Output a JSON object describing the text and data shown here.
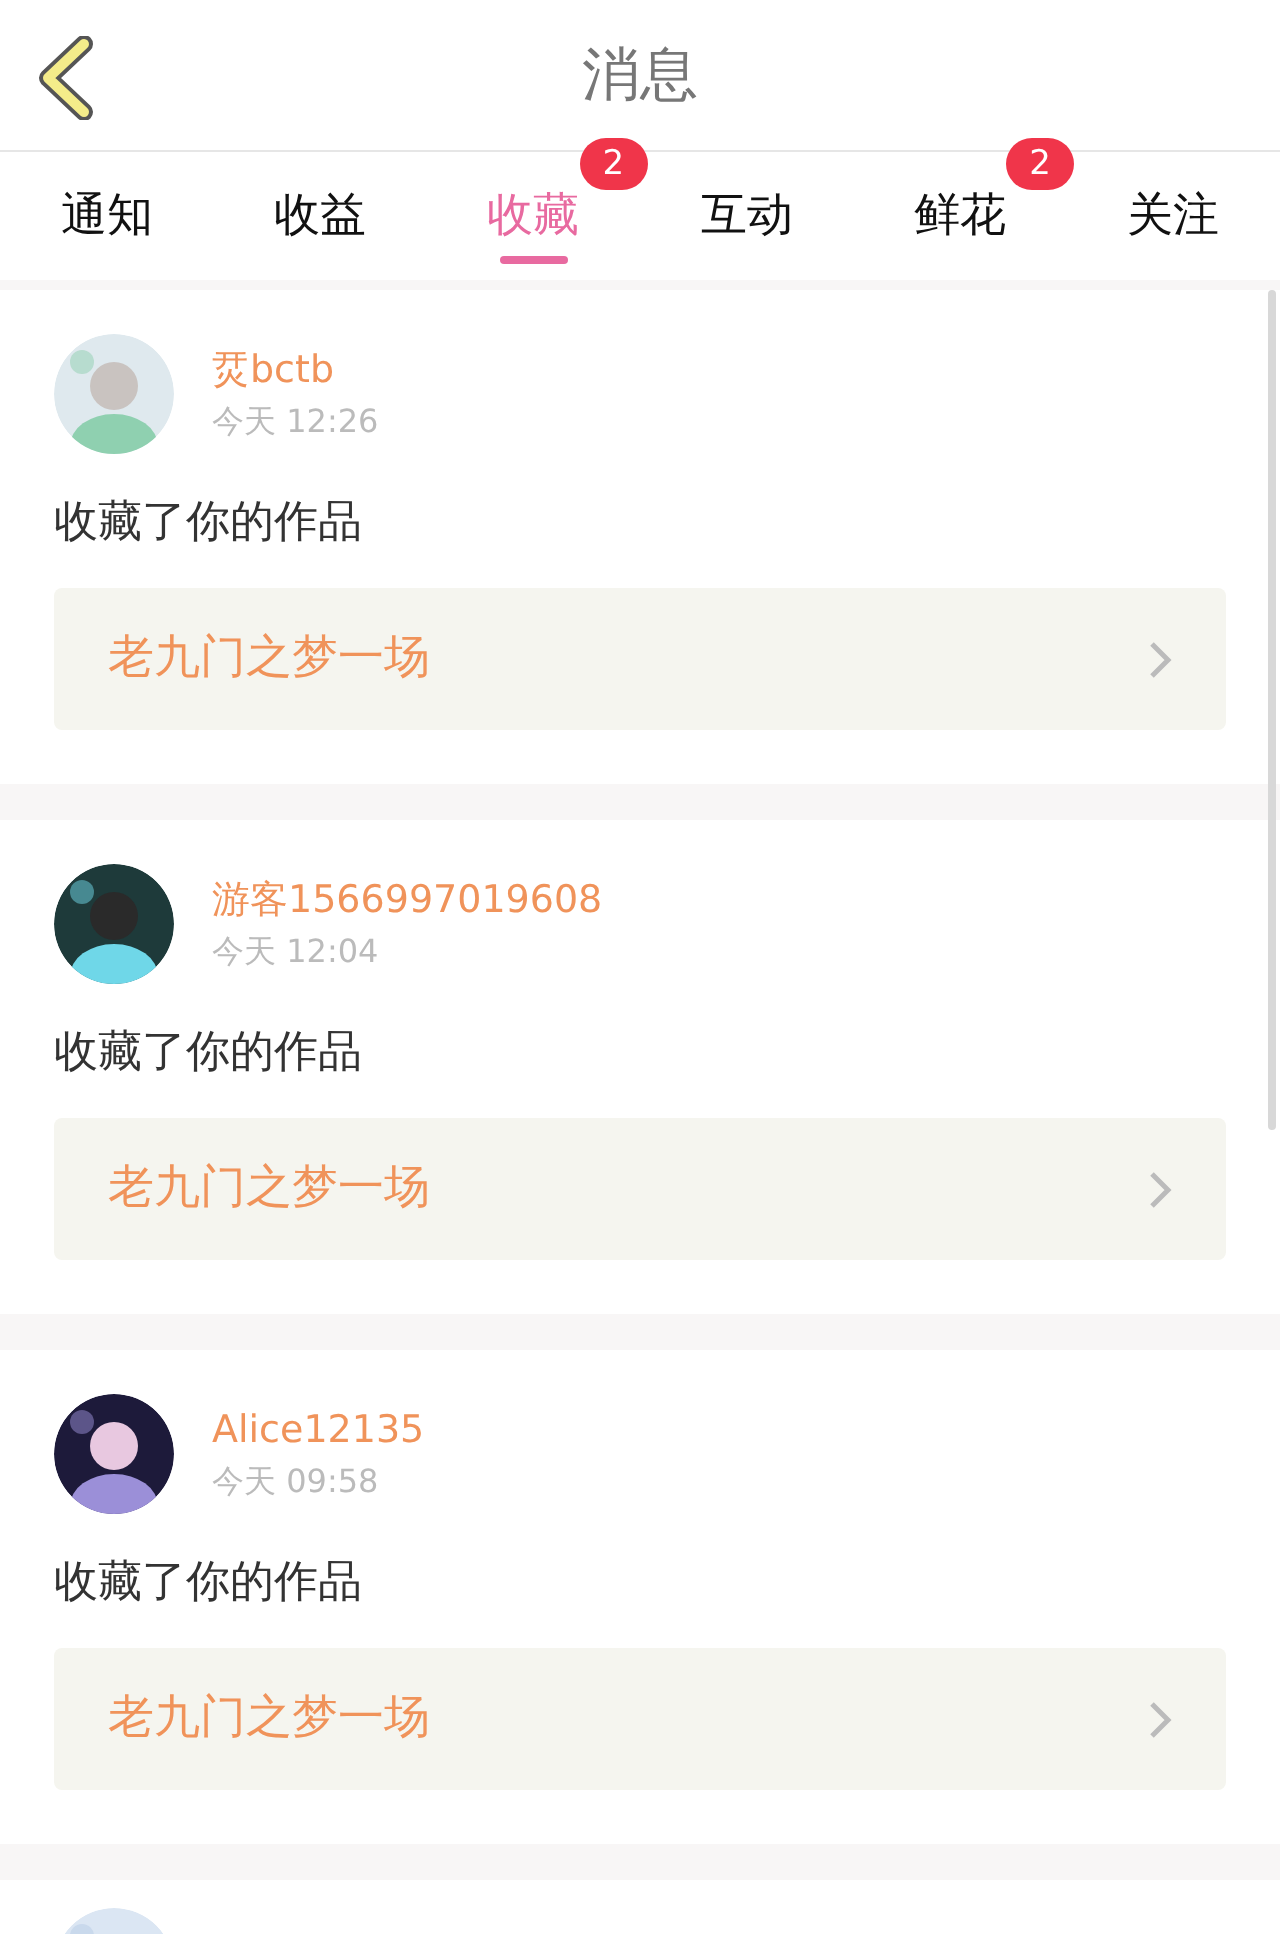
{
  "header": {
    "title": "消息"
  },
  "tabs": [
    {
      "label": "通知",
      "selected": false
    },
    {
      "label": "收益",
      "selected": false
    },
    {
      "label": "收藏",
      "selected": true,
      "badge": "2"
    },
    {
      "label": "互动",
      "selected": false
    },
    {
      "label": "鲜花",
      "selected": false,
      "badge": "2"
    },
    {
      "label": "关注",
      "selected": false
    }
  ],
  "messages": [
    {
      "user": "烎bctb",
      "time": "今天 12:26",
      "action": "收藏了你的作品",
      "work": "老九门之梦一场"
    },
    {
      "user": "游客1566997019608",
      "time": "今天 12:04",
      "action": "收藏了你的作品",
      "work": "老九门之梦一场"
    },
    {
      "user": "Alice12135",
      "time": "今天 09:58",
      "action": "收藏了你的作品",
      "work": "老九门之梦一场"
    }
  ]
}
